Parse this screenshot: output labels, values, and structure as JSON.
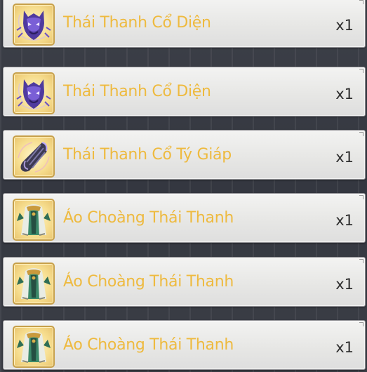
{
  "items": [
    {
      "name": "Thái Thanh Cổ Diện",
      "qty": "x1",
      "icon": "mask-icon"
    },
    {
      "name": "Thái Thanh Cổ Diện",
      "qty": "x1",
      "icon": "mask-icon"
    },
    {
      "name": "Thái Thanh Cổ Tý Giáp",
      "qty": "x1",
      "icon": "armguard-icon"
    },
    {
      "name": "Áo Choàng Thái Thanh",
      "qty": "x1",
      "icon": "cloak-icon"
    },
    {
      "name": "Áo Choàng Thái Thanh",
      "qty": "x1",
      "icon": "cloak-icon"
    },
    {
      "name": "Áo Choàng Thái Thanh",
      "qty": "x1",
      "icon": "cloak-icon"
    }
  ],
  "colors": {
    "item_name": "#eeba3f",
    "quantity": "#2f2f2f",
    "icon_frame": "#c7a04a",
    "icon_background": "#f6dd8e",
    "row_background": "#e7e7e5"
  }
}
